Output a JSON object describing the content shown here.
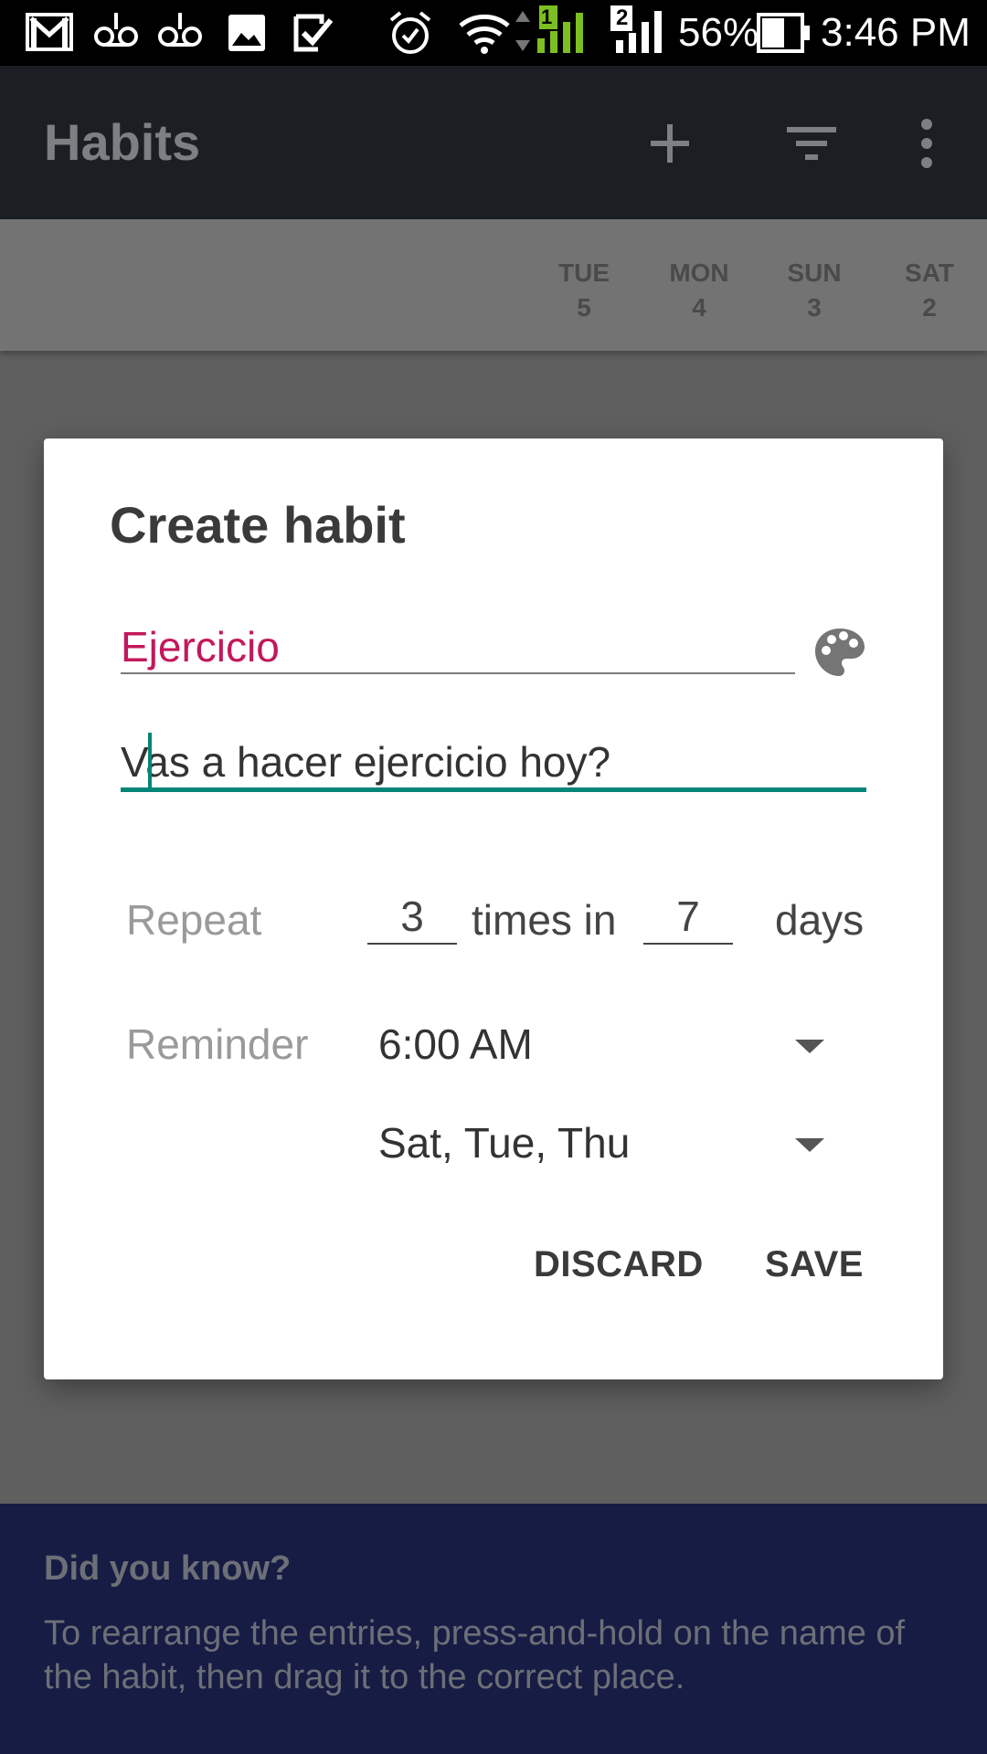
{
  "status_bar": {
    "battery_percent": "56%",
    "time": "3:46 PM",
    "sim_1": "1",
    "sim_2": "2",
    "icons": [
      "gmail-icon",
      "voicemail-icon",
      "voicemail-icon",
      "image-icon",
      "task-check-icon",
      "alarm-icon",
      "wifi-icon",
      "signal-icon",
      "signal-icon",
      "battery-icon"
    ]
  },
  "appbar": {
    "title": "Habits",
    "actions": [
      "add-icon",
      "filter-icon",
      "more-vert-icon"
    ]
  },
  "day_header": [
    {
      "dow": "TUE",
      "date": "5"
    },
    {
      "dow": "MON",
      "date": "4"
    },
    {
      "dow": "SUN",
      "date": "3"
    },
    {
      "dow": "SAT",
      "date": "2"
    }
  ],
  "dialog": {
    "title": "Create habit",
    "name_value": "Ejercicio",
    "question_value": "Vas a hacer ejercicio hoy?",
    "repeat_label": "Repeat",
    "repeat_times": "3",
    "times_in_label": "times in",
    "repeat_days": "7",
    "days_label": "days",
    "reminder_label": "Reminder",
    "reminder_time": "6:00 AM",
    "reminder_days": "Sat, Tue, Thu",
    "discard_label": "DISCARD",
    "save_label": "SAVE",
    "accent_color": "#008577",
    "name_color": "#c2185b"
  },
  "tip": {
    "title": "Did you know?",
    "body": "To rearrange the entries, press-and-hold on the name of the habit, then drag it to the correct place."
  }
}
